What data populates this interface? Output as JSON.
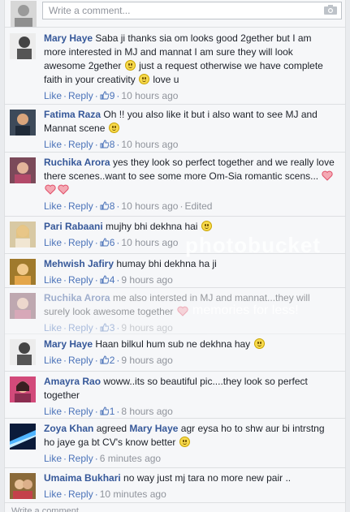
{
  "composer": {
    "placeholder": "Write a comment..."
  },
  "comments": [
    {
      "author": "Mary Haye",
      "text_parts": [
        "Saba ji thanks sia om looks good 2gether but I am more interested in MJ and mannat I am sure they will look awesome 2gether ",
        " just a request otherwise we have complete faith in your creativity ",
        " love u"
      ],
      "like": "Like",
      "reply": "Reply",
      "likes": "9",
      "time": "10 hours ago"
    },
    {
      "author": "Fatima Raza",
      "text_parts": [
        "Oh !! you also like it but i also want to see MJ and Mannat scene "
      ],
      "like": "Like",
      "reply": "Reply",
      "likes": "8",
      "time": "10 hours ago"
    },
    {
      "author": "Ruchika Arora",
      "text_parts": [
        "yes they look so perfect together and we really love there scenes..want to see some more Om-Sia romantic scens... "
      ],
      "like": "Like",
      "reply": "Reply",
      "likes": "8",
      "time": "10 hours ago",
      "edited": "Edited"
    },
    {
      "author": "Pari Rabaani",
      "text_parts": [
        "mujhy bhi dekhna hai "
      ],
      "like": "Like",
      "reply": "Reply",
      "likes": "6",
      "time": "10 hours ago"
    },
    {
      "author": "Mehwish Jafiry",
      "text_parts": [
        "humay bhi dekhna ha ji"
      ],
      "like": "Like",
      "reply": "Reply",
      "likes": "4",
      "time": "9 hours ago"
    },
    {
      "author": "Ruchika Arora",
      "text_parts": [
        "me also intersted in MJ and mannat...they will surely look awesome together "
      ],
      "like": "Like",
      "reply": "Reply",
      "likes": "3",
      "time": "9 hours ago"
    },
    {
      "author": "Mary Haye",
      "text_parts": [
        "Haan bilkul hum sub ne dekhna hay "
      ],
      "like": "Like",
      "reply": "Reply",
      "likes": "2",
      "time": "9 hours ago"
    },
    {
      "author": "Amayra Rao",
      "text_parts": [
        "woww..its so beautiful pic....they look so perfect together"
      ],
      "like": "Like",
      "reply": "Reply",
      "likes": "1",
      "time": "8 hours ago"
    },
    {
      "author": "Zoya Khan",
      "text_parts": [
        "agreed ",
        "Mary Haye",
        " agr eysa ho to shw aur bi intrstng ho jaye ga bt CV's know better "
      ],
      "like": "Like",
      "reply": "Reply",
      "time": "6 minutes ago"
    },
    {
      "author": "Umaima Bukhari",
      "text_parts": [
        "no way just mj tara no more new pair .."
      ],
      "like": "Like",
      "reply": "Reply",
      "time": "10 minutes ago"
    }
  ],
  "watermark": {
    "brand": "photobucket",
    "tagline": "memories for less!"
  },
  "footer": {
    "placeholder": "Write a comment..."
  },
  "colors": {
    "link": "#365899",
    "action": "#4b73b9",
    "meta": "#90949c"
  }
}
